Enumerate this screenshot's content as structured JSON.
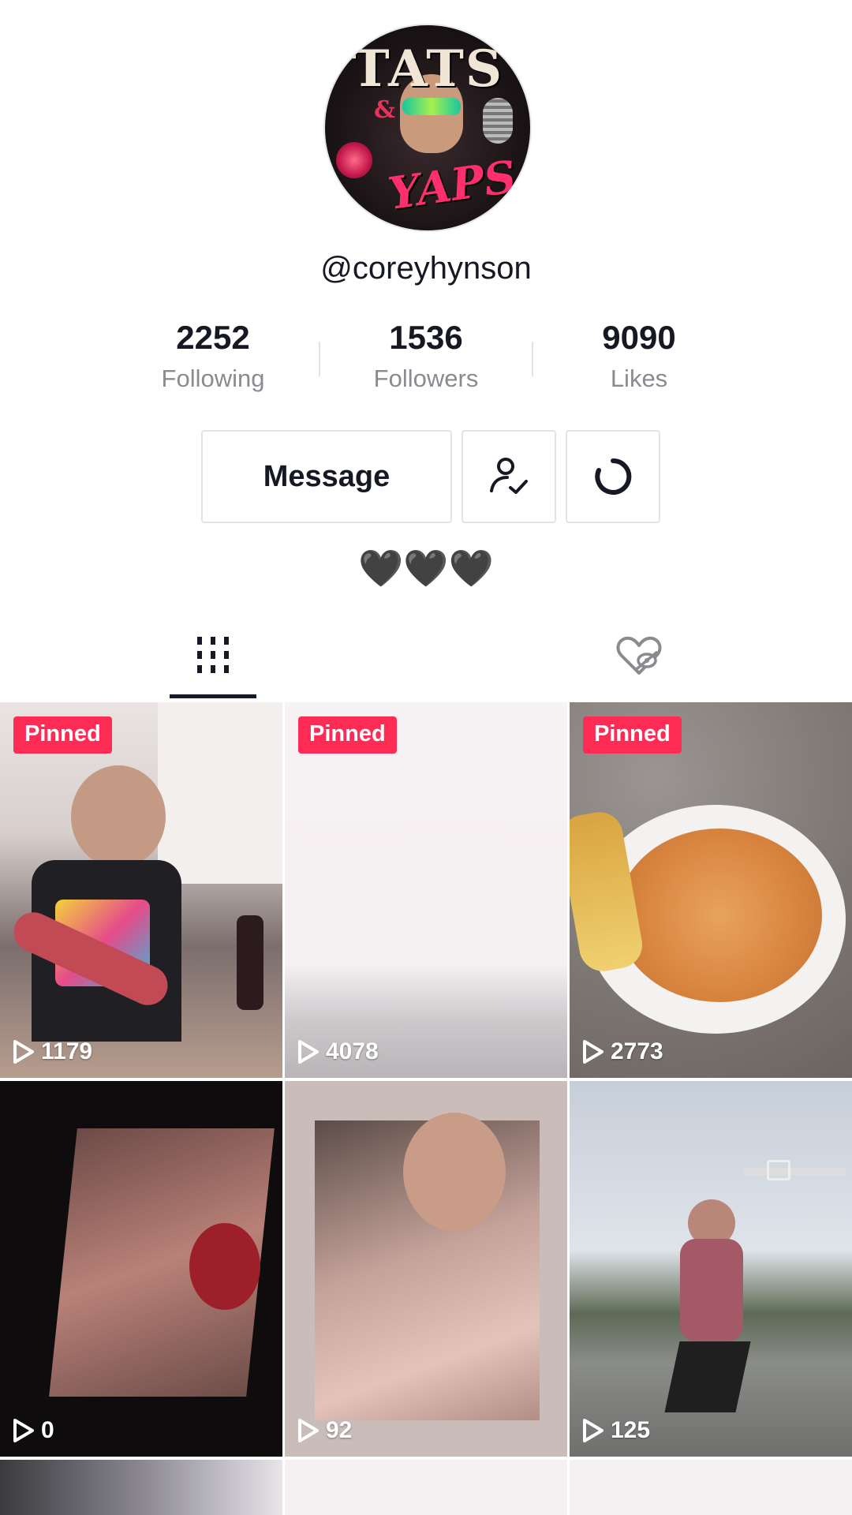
{
  "profile": {
    "username": "@coreyhynson",
    "avatar_text": {
      "top": "TATS",
      "amp": "&",
      "bottom": "YAPS"
    },
    "bio": "🖤🖤🖤"
  },
  "stats": [
    {
      "value": "2252",
      "label": "Following"
    },
    {
      "value": "1536",
      "label": "Followers"
    },
    {
      "value": "9090",
      "label": "Likes"
    }
  ],
  "actions": {
    "message_label": "Message",
    "friends_icon": "user-check-icon",
    "more_icon": "refresh-circle-icon"
  },
  "tabs": [
    {
      "name": "videos",
      "icon": "grid-icon",
      "active": true
    },
    {
      "name": "liked",
      "icon": "heart-hidden-icon",
      "active": false
    }
  ],
  "videos": [
    {
      "pinned": true,
      "pinned_label": "Pinned",
      "views": "1179",
      "theme": "kitchen-meat"
    },
    {
      "pinned": true,
      "pinned_label": "Pinned",
      "views": "4078",
      "theme": "blank-light"
    },
    {
      "pinned": true,
      "pinned_label": "Pinned",
      "views": "2773",
      "theme": "pasta-bowl"
    },
    {
      "pinned": false,
      "views": "0",
      "theme": "dark-tattoo"
    },
    {
      "pinned": false,
      "views": "92",
      "theme": "neck-tattoo"
    },
    {
      "pinned": false,
      "views": "125",
      "theme": "basketball"
    }
  ],
  "colors": {
    "accent": "#fe2c55",
    "text": "#161823",
    "muted": "#8a8b91",
    "border": "#e3e3e4"
  }
}
